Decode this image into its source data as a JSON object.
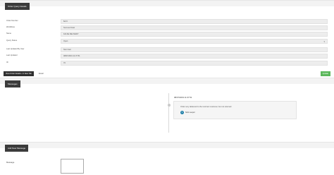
{
  "details_panel": {
    "title": "Order Query Details",
    "fields": [
      {
        "label": "Order Number",
        "value": "8ef 0",
        "type": "text"
      },
      {
        "label": "Workflows",
        "value": "Summer Deal",
        "type": "text"
      },
      {
        "label": "Name",
        "value": "FALSE DELIVERY",
        "type": "text"
      },
      {
        "label": "Query Status",
        "value": "Open",
        "type": "select"
      },
      {
        "label": "Last Updated By User",
        "value": "Non User",
        "type": "text"
      },
      {
        "label": "Last Updated",
        "value": "08/07/2019 11:37:51",
        "type": "text"
      },
      {
        "label": "ID",
        "value": "70",
        "type": "text"
      }
    ]
  },
  "actions": {
    "view_order_label": "View Order Details • In New Tab",
    "email_label": "Email",
    "update_label": "Update"
  },
  "messages_panel": {
    "title": "Messages",
    "items": [
      {
        "date": "08/07/2019 11:37:51",
        "text": "Order very delivered to the incorrect customer, but not returned",
        "avatar_initial": "S",
        "author": "Nick Leeper"
      }
    ]
  },
  "new_message_panel": {
    "title": "Add New Message",
    "message_label": "Message",
    "message_value": ""
  }
}
